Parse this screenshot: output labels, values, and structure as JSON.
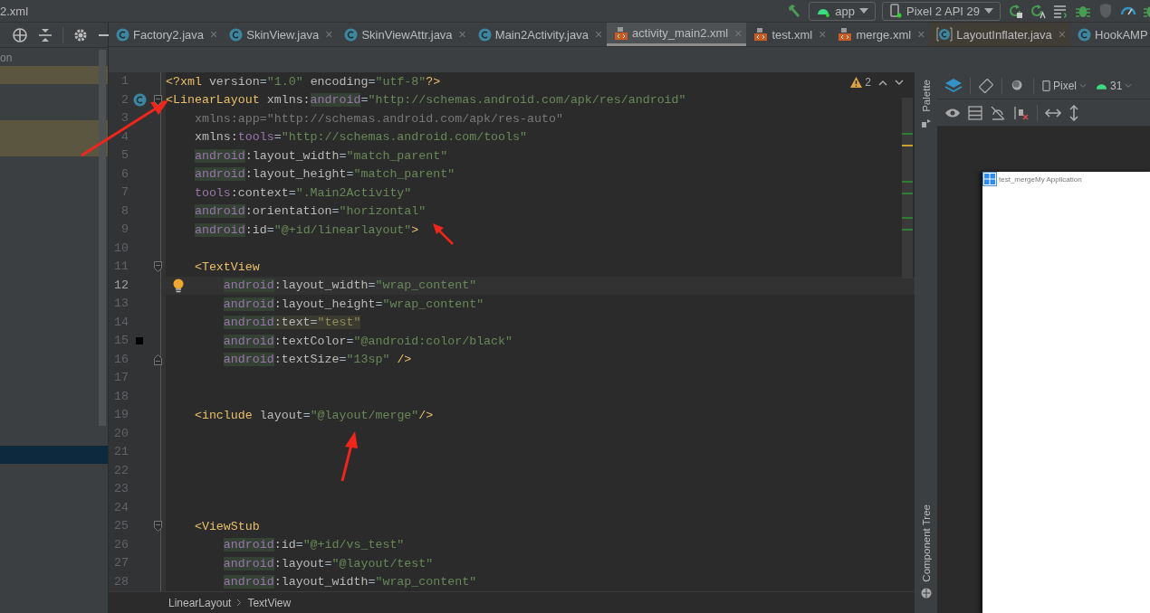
{
  "title_bar": {
    "title": "2.xml",
    "run_config": "app",
    "device": "Pixel 2 API 29"
  },
  "project_panel": {
    "header": "on",
    "rows": [
      {
        "highlighted": true,
        "selected": false
      },
      {
        "highlighted": false,
        "selected": false
      },
      {
        "highlighted": false,
        "selected": false
      },
      {
        "highlighted": true,
        "selected": false
      },
      {
        "highlighted": true,
        "selected": false
      },
      {
        "highlighted": false,
        "selected": false
      },
      {
        "highlighted": false,
        "selected": false
      },
      {
        "highlighted": false,
        "selected": false
      },
      {
        "highlighted": false,
        "selected": false
      },
      {
        "highlighted": false,
        "selected": false
      },
      {
        "highlighted": false,
        "selected": false
      },
      {
        "highlighted": false,
        "selected": false
      },
      {
        "highlighted": false,
        "selected": false
      },
      {
        "highlighted": false,
        "selected": false
      },
      {
        "highlighted": false,
        "selected": false
      },
      {
        "highlighted": false,
        "selected": false
      },
      {
        "highlighted": false,
        "selected": false
      },
      {
        "highlighted": false,
        "selected": false
      },
      {
        "highlighted": false,
        "selected": false
      },
      {
        "highlighted": false,
        "selected": false
      },
      {
        "highlighted": false,
        "selected": false
      },
      {
        "highlighted": false,
        "selected": true
      }
    ]
  },
  "tabs": [
    {
      "label": "Factory2.java",
      "kind": "java",
      "selected": false,
      "close": "×"
    },
    {
      "label": "SkinView.java",
      "kind": "java",
      "selected": false,
      "close": "×"
    },
    {
      "label": "SkinViewAttr.java",
      "kind": "java",
      "selected": false,
      "close": "×"
    },
    {
      "label": "Main2Activity.java",
      "kind": "java",
      "selected": false,
      "close": "×"
    },
    {
      "label": "activity_main2.xml",
      "kind": "xml",
      "selected": true,
      "close": "×"
    },
    {
      "label": "test.xml",
      "kind": "xml",
      "selected": false,
      "close": "×"
    },
    {
      "label": "merge.xml",
      "kind": "xml",
      "selected": false,
      "close": "×"
    },
    {
      "label": "LayoutInflater.java",
      "kind": "library",
      "selected": false,
      "close": "×"
    },
    {
      "label": "HookAMP",
      "kind": "java",
      "selected": false
    }
  ],
  "editor": {
    "warnings": "2",
    "lines": [
      {
        "number": "1",
        "current": false,
        "tokens": [
          {
            "kind": "tag",
            "text": "<?xml "
          },
          {
            "kind": "attr",
            "text": "version"
          },
          {
            "kind": "plain",
            "text": "="
          },
          {
            "kind": "str",
            "text": "\"1.0\""
          },
          {
            "kind": "attr",
            "text": " encoding"
          },
          {
            "kind": "plain",
            "text": "="
          },
          {
            "kind": "str",
            "text": "\"utf-8\""
          },
          {
            "kind": "tag",
            "text": "?>"
          }
        ]
      },
      {
        "number": "2",
        "current": false,
        "gutter_icon": {
          "kind": "class"
        },
        "fold": {
          "kind": "start"
        },
        "tokens": [
          {
            "kind": "tag",
            "text": "<LinearLayout "
          },
          {
            "kind": "attr",
            "text": "xmlns:"
          },
          {
            "kind": "ns-hl",
            "text": "android"
          },
          {
            "kind": "plain",
            "text": "="
          },
          {
            "kind": "str",
            "text": "\"http://schemas.android.com/apk/res/android\""
          }
        ]
      },
      {
        "number": "3",
        "current": false,
        "tokens": [
          {
            "kind": "unused",
            "text": "    xmlns:app=\"http://schemas.android.com/apk/res-auto\""
          }
        ]
      },
      {
        "number": "4",
        "current": false,
        "tokens": [
          {
            "kind": "attr",
            "text": "    xmlns:"
          },
          {
            "kind": "ns",
            "text": "tools"
          },
          {
            "kind": "plain",
            "text": "="
          },
          {
            "kind": "str",
            "text": "\"http://schemas.android.com/tools\""
          }
        ]
      },
      {
        "number": "5",
        "current": false,
        "tokens": [
          {
            "kind": "ns-hl",
            "text": "    android"
          },
          {
            "kind": "attr",
            "text": ":layout_width"
          },
          {
            "kind": "plain",
            "text": "="
          },
          {
            "kind": "str",
            "text": "\"match_parent\""
          }
        ]
      },
      {
        "number": "6",
        "current": false,
        "tokens": [
          {
            "kind": "ns-hl",
            "text": "    android"
          },
          {
            "kind": "attr",
            "text": ":layout_height"
          },
          {
            "kind": "plain",
            "text": "="
          },
          {
            "kind": "str",
            "text": "\"match_parent\""
          }
        ]
      },
      {
        "number": "7",
        "current": false,
        "tokens": [
          {
            "kind": "ns",
            "text": "    tools"
          },
          {
            "kind": "attr",
            "text": ":context"
          },
          {
            "kind": "plain",
            "text": "="
          },
          {
            "kind": "str",
            "text": "\".Main2Activity\""
          }
        ]
      },
      {
        "number": "8",
        "current": false,
        "tokens": [
          {
            "kind": "ns-hl",
            "text": "    android"
          },
          {
            "kind": "attr",
            "text": ":orientation"
          },
          {
            "kind": "plain",
            "text": "="
          },
          {
            "kind": "str",
            "text": "\"horizontal\""
          }
        ]
      },
      {
        "number": "9",
        "current": false,
        "tokens": [
          {
            "kind": "ns-hl",
            "text": "    android"
          },
          {
            "kind": "attr",
            "text": ":id"
          },
          {
            "kind": "plain",
            "text": "="
          },
          {
            "kind": "str",
            "text": "\"@+id/linearlayout\""
          },
          {
            "kind": "tag",
            "text": ">"
          }
        ]
      },
      {
        "number": "10",
        "current": false
      },
      {
        "number": "11",
        "current": false,
        "fold": {
          "kind": "start"
        },
        "tokens": [
          {
            "kind": "tag",
            "text": "    <TextView"
          }
        ]
      },
      {
        "number": "12",
        "current": true,
        "gutter_icon": {
          "kind": "bulb"
        },
        "tokens": [
          {
            "kind": "ns-hl",
            "text": "        android"
          },
          {
            "kind": "attr",
            "text": ":layout_width"
          },
          {
            "kind": "plain",
            "text": "="
          },
          {
            "kind": "str",
            "text": "\"wrap_content\""
          }
        ]
      },
      {
        "number": "13",
        "current": false,
        "tokens": [
          {
            "kind": "ns-hl",
            "text": "        android"
          },
          {
            "kind": "attr",
            "text": ":layout_height"
          },
          {
            "kind": "plain",
            "text": "="
          },
          {
            "kind": "str",
            "text": "\"wrap_content\""
          }
        ]
      },
      {
        "number": "14",
        "current": false,
        "tokens": [
          {
            "kind": "ns-hl",
            "text": "        android"
          },
          {
            "kind": "attr-hl",
            "text": ":text"
          },
          {
            "kind": "plain-hl",
            "text": "="
          },
          {
            "kind": "str-hl",
            "text": "\"test\""
          }
        ]
      },
      {
        "number": "15",
        "current": false,
        "gutter_icon": {
          "kind": "swatch"
        },
        "tokens": [
          {
            "kind": "ns-hl",
            "text": "        android"
          },
          {
            "kind": "attr",
            "text": ":textColor"
          },
          {
            "kind": "plain",
            "text": "="
          },
          {
            "kind": "str",
            "text": "\"@android:color/black\""
          }
        ]
      },
      {
        "number": "16",
        "current": false,
        "fold": {
          "kind": "end"
        },
        "tokens": [
          {
            "kind": "ns-hl",
            "text": "        android"
          },
          {
            "kind": "attr",
            "text": ":textSize"
          },
          {
            "kind": "plain",
            "text": "="
          },
          {
            "kind": "str",
            "text": "\"13sp\""
          },
          {
            "kind": "tag",
            "text": " />"
          }
        ]
      },
      {
        "number": "17",
        "current": false
      },
      {
        "number": "18",
        "current": false
      },
      {
        "number": "19",
        "current": false,
        "tokens": [
          {
            "kind": "tag",
            "text": "    <include "
          },
          {
            "kind": "attr",
            "text": "layout"
          },
          {
            "kind": "plain",
            "text": "="
          },
          {
            "kind": "str",
            "text": "\"@layout/merge\""
          },
          {
            "kind": "tag",
            "text": "/>"
          }
        ]
      },
      {
        "number": "20",
        "current": false
      },
      {
        "number": "21",
        "current": false
      },
      {
        "number": "22",
        "current": false
      },
      {
        "number": "23",
        "current": false
      },
      {
        "number": "24",
        "current": false
      },
      {
        "number": "25",
        "current": false,
        "fold": {
          "kind": "start"
        },
        "tokens": [
          {
            "kind": "tag",
            "text": "    <ViewStub"
          }
        ]
      },
      {
        "number": "26",
        "current": false,
        "tokens": [
          {
            "kind": "ns-hl",
            "text": "        android"
          },
          {
            "kind": "attr",
            "text": ":id"
          },
          {
            "kind": "plain",
            "text": "="
          },
          {
            "kind": "str",
            "text": "\"@+id/vs_test\""
          }
        ]
      },
      {
        "number": "27",
        "current": false,
        "tokens": [
          {
            "kind": "ns-hl",
            "text": "        android"
          },
          {
            "kind": "attr",
            "text": ":layout"
          },
          {
            "kind": "plain",
            "text": "="
          },
          {
            "kind": "str",
            "text": "\"@layout/test\""
          }
        ]
      },
      {
        "number": "28",
        "current": false,
        "tokens": [
          {
            "kind": "ns-hl",
            "text": "        android"
          },
          {
            "kind": "attr",
            "text": ":layout_width"
          },
          {
            "kind": "plain",
            "text": "="
          },
          {
            "kind": "str",
            "text": "\"wrap_content\""
          }
        ]
      }
    ]
  },
  "breadcrumb": [
    "LinearLayout",
    "TextView"
  ],
  "side_strip": {
    "top": "Palette",
    "bottom": "Component Tree"
  },
  "design": {
    "device": "Pixel",
    "api": "31",
    "preview_text": "test_mergeMy Application"
  }
}
